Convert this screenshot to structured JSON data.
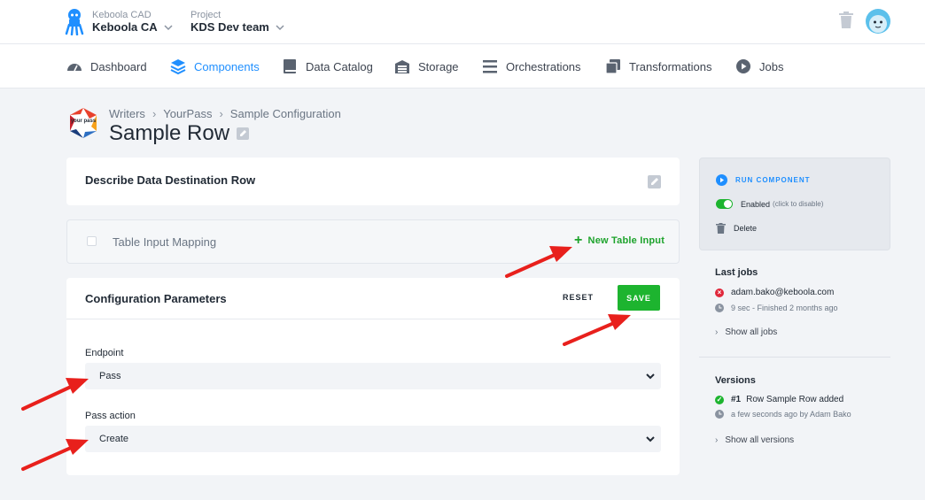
{
  "header": {
    "org_label": "Keboola CAD",
    "org_value": "Keboola CA",
    "project_label": "Project",
    "project_value": "KDS Dev team"
  },
  "nav": {
    "items": [
      {
        "label": "Dashboard",
        "icon": "dashboard-icon"
      },
      {
        "label": "Components",
        "icon": "layers-icon",
        "active": true
      },
      {
        "label": "Data Catalog",
        "icon": "book-icon"
      },
      {
        "label": "Storage",
        "icon": "storage-icon"
      },
      {
        "label": "Orchestrations",
        "icon": "list-icon"
      },
      {
        "label": "Transformations",
        "icon": "transform-icon"
      },
      {
        "label": "Jobs",
        "icon": "play-icon"
      }
    ]
  },
  "breadcrumb": [
    "Writers",
    "YourPass",
    "Sample Configuration"
  ],
  "component_logo_text": "your pass",
  "page_title": "Sample Row",
  "description_card": {
    "label": "Describe Data Destination Row"
  },
  "table_input": {
    "label": "Table Input Mapping",
    "new_label": "New Table Input"
  },
  "config": {
    "title": "Configuration Parameters",
    "reset_label": "RESET",
    "save_label": "SAVE",
    "fields": [
      {
        "label": "Endpoint",
        "value": "Pass"
      },
      {
        "label": "Pass action",
        "value": "Create"
      }
    ]
  },
  "sidebar": {
    "run_label": "RUN COMPONENT",
    "enabled_label": "Enabled",
    "enabled_hint": "(click to disable)",
    "delete_label": "Delete",
    "last_jobs_title": "Last jobs",
    "last_job_user": "adam.bako@keboola.com",
    "last_job_status": "9 sec - Finished 2 months ago",
    "show_all_jobs": "Show all jobs",
    "versions_title": "Versions",
    "version_number": "#1",
    "version_desc": "Row Sample Row added",
    "version_meta": "a few seconds ago by Adam Bako",
    "show_all_versions": "Show all versions"
  },
  "colors": {
    "accent": "#1f8fff",
    "success": "#1db42f",
    "error": "#e0283b",
    "annotation_arrow": "#e8201c"
  }
}
